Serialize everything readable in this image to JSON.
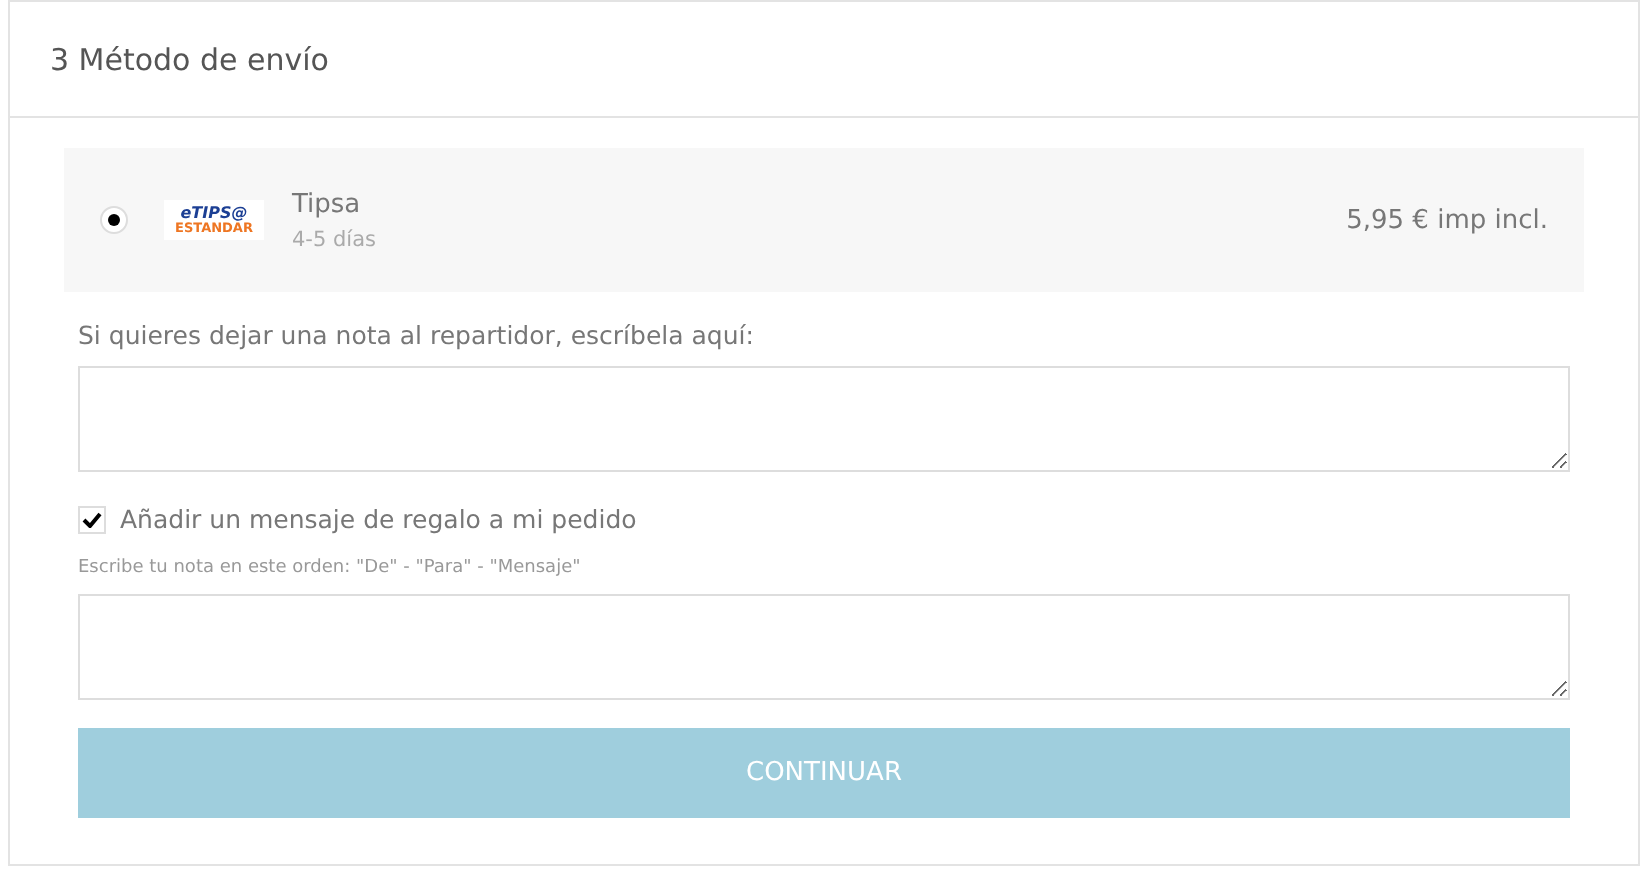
{
  "section": {
    "title": "3 Método de envío"
  },
  "carriers": [
    {
      "logo": {
        "top": "eTIPS@",
        "bottom": "ESTANDAR"
      },
      "name": "Tipsa",
      "delay": "4-5 días",
      "price": "5,95 € imp incl.",
      "selected": true
    }
  ],
  "delivery_note": {
    "label": "Si quieres dejar una nota al repartidor, escríbela aquí:"
  },
  "gift": {
    "label": "Añadir un mensaje de regalo a mi pedido",
    "checked": true,
    "hint": "Escribe tu nota en este orden: \"De\" - \"Para\" - \"Mensaje\""
  },
  "continue_button": {
    "label": "CONTINUAR"
  }
}
